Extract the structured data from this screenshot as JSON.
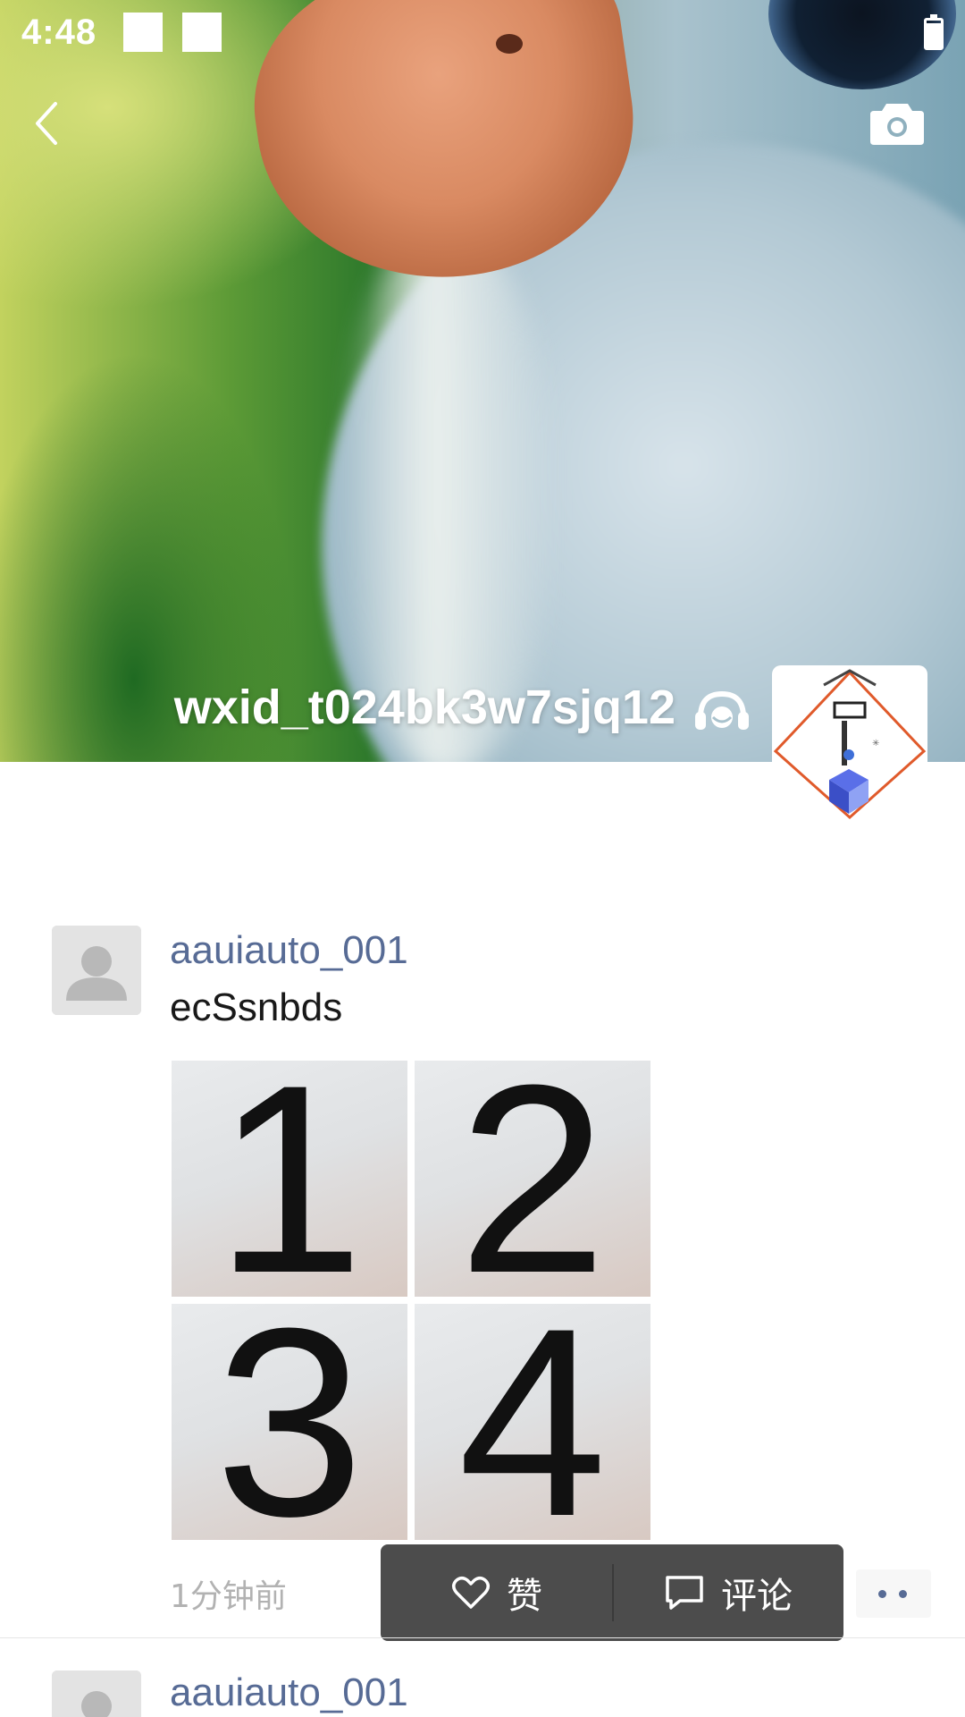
{
  "status_bar": {
    "time": "4:48"
  },
  "header": {
    "back_icon": "chevron-left-icon",
    "camera_icon": "camera-icon"
  },
  "profile": {
    "name": "wxid_t024bk3w7sjq12",
    "status_icon": "headset-icon",
    "avatar_icon": "logo-avatar"
  },
  "posts": [
    {
      "author": "aauiauto_001",
      "text": "ecSsnbds",
      "photos": [
        "1",
        "2",
        "3",
        "4"
      ],
      "time": "1分钟前"
    },
    {
      "author": "aauiauto_001"
    }
  ],
  "action_popup": {
    "like_label": "赞",
    "comment_label": "评论",
    "like_icon": "heart-outline-icon",
    "comment_icon": "comment-bubble-icon"
  },
  "more_icon": "more-dots-icon",
  "colors": {
    "link_blue": "#576b95",
    "popup_bg": "#4c4c4c",
    "timestamp_grey": "#b2b2b2"
  }
}
